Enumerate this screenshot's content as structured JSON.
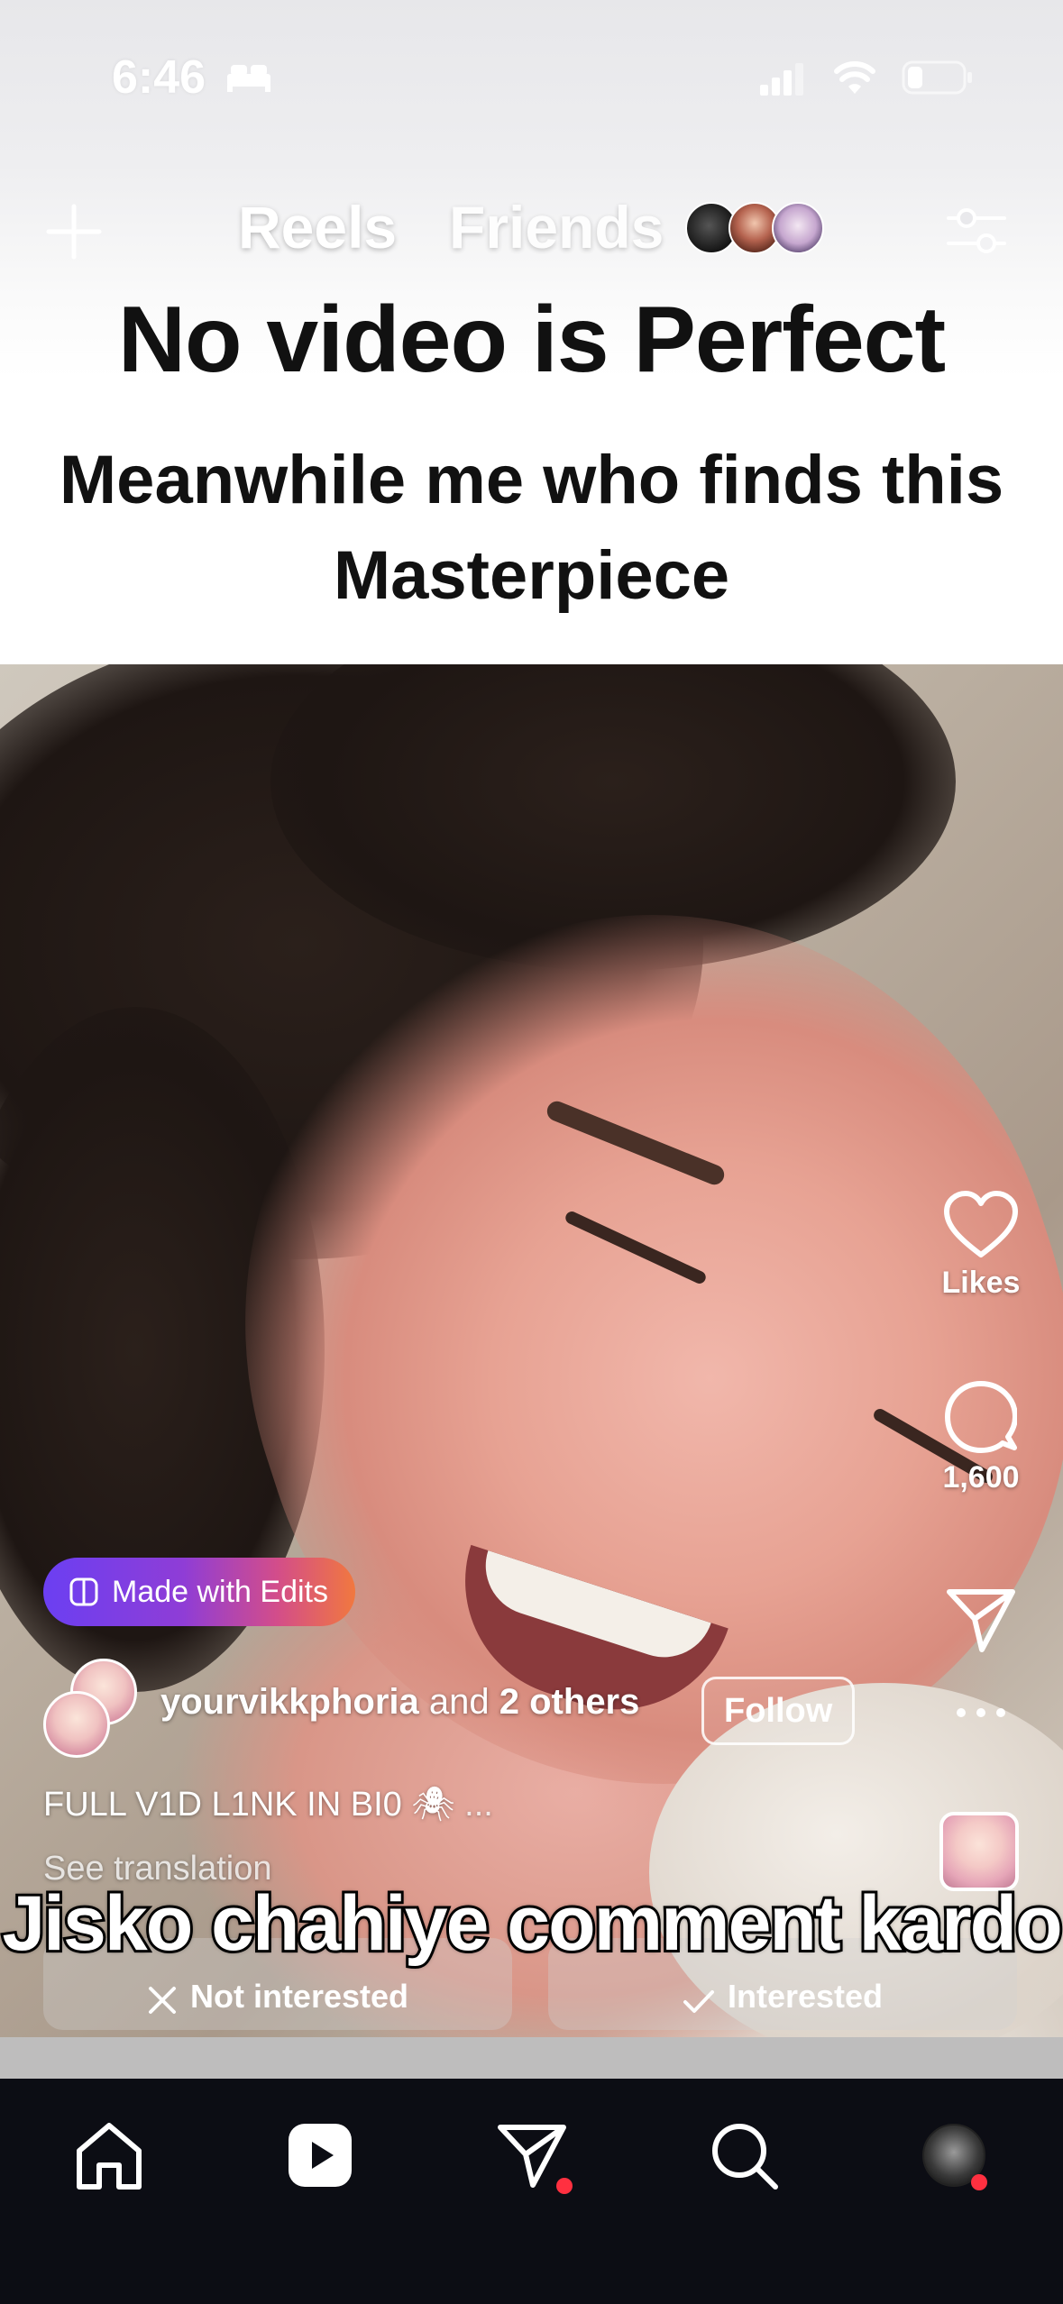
{
  "status_bar": {
    "time": "6:46",
    "icons": [
      "sleep-focus-icon",
      "cellular-signal-icon",
      "wifi-icon",
      "battery-icon"
    ]
  },
  "top_nav": {
    "tabs": [
      {
        "label": "Reels",
        "active": true
      },
      {
        "label": "Friends",
        "active": false
      }
    ],
    "left_icon": "plus-icon",
    "right_icon": "filter-sliders-icon"
  },
  "video_caption": {
    "headline": "No video is Perfect",
    "subline_1": "Meanwhile me who finds this",
    "subline_2": "Masterpiece"
  },
  "actions": {
    "like_label": "Likes",
    "comment_count": "1,600",
    "share_icon": "send-icon",
    "more_icon": "more-horizontal-icon"
  },
  "edits_pill": {
    "label": "Made with Edits"
  },
  "author": {
    "username": "yourvikkphoria",
    "and_text": "and",
    "others": "2 others",
    "follow_label": "Follow"
  },
  "description": {
    "text": "FULL V1D L1NK IN BI0",
    "emoji": "🕷",
    "ellipsis": "...",
    "see_translation": "See translation"
  },
  "overlay_caption": "Jisko chahiye comment kardo",
  "feedback": {
    "not_interested": "Not interested",
    "interested": "Interested"
  },
  "bottom_nav": {
    "items": [
      "home-icon",
      "reels-icon",
      "direct-messages-icon",
      "search-icon",
      "profile-avatar"
    ],
    "notification_color": "#ff3040"
  },
  "colors": {
    "nav_background": "#0c0d14",
    "edits_gradient_start": "#6b3ff2",
    "edits_gradient_end": "#f1783f"
  }
}
